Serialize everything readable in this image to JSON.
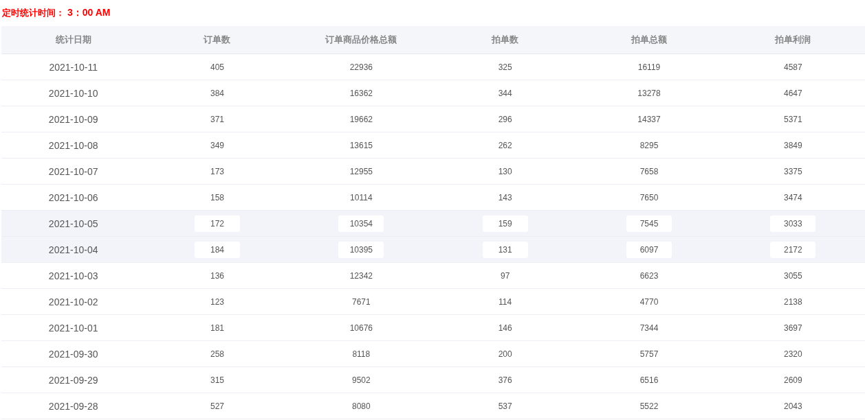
{
  "schedule_label": "定时统计时间：",
  "schedule_time": "3：00 AM",
  "table": {
    "columns": [
      "统计日期",
      "订单数",
      "订单商品价格总额",
      "拍单数",
      "拍单总额",
      "拍单利润"
    ],
    "rows": [
      {
        "cells": [
          "2021-10-11",
          "405",
          "22936",
          "325",
          "16119",
          "4587"
        ],
        "highlighted": false
      },
      {
        "cells": [
          "2021-10-10",
          "384",
          "16362",
          "344",
          "13278",
          "4647"
        ],
        "highlighted": false
      },
      {
        "cells": [
          "2021-10-09",
          "371",
          "19662",
          "296",
          "14337",
          "5371"
        ],
        "highlighted": false
      },
      {
        "cells": [
          "2021-10-08",
          "349",
          "13615",
          "262",
          "8295",
          "3849"
        ],
        "highlighted": false
      },
      {
        "cells": [
          "2021-10-07",
          "173",
          "12955",
          "130",
          "7658",
          "3375"
        ],
        "highlighted": false
      },
      {
        "cells": [
          "2021-10-06",
          "158",
          "10114",
          "143",
          "7650",
          "3474"
        ],
        "highlighted": false
      },
      {
        "cells": [
          "2021-10-05",
          "172",
          "10354",
          "159",
          "7545",
          "3033"
        ],
        "highlighted": true
      },
      {
        "cells": [
          "2021-10-04",
          "184",
          "10395",
          "131",
          "6097",
          "2172"
        ],
        "highlighted": true
      },
      {
        "cells": [
          "2021-10-03",
          "136",
          "12342",
          "97",
          "6623",
          "3055"
        ],
        "highlighted": false
      },
      {
        "cells": [
          "2021-10-02",
          "123",
          "7671",
          "114",
          "4770",
          "2138"
        ],
        "highlighted": false
      },
      {
        "cells": [
          "2021-10-01",
          "181",
          "10676",
          "146",
          "7344",
          "3697"
        ],
        "highlighted": false
      },
      {
        "cells": [
          "2021-09-30",
          "258",
          "8118",
          "200",
          "5757",
          "2320"
        ],
        "highlighted": false
      },
      {
        "cells": [
          "2021-09-29",
          "315",
          "9502",
          "376",
          "6516",
          "2609"
        ],
        "highlighted": false
      },
      {
        "cells": [
          "2021-09-28",
          "527",
          "8080",
          "537",
          "5522",
          "2043"
        ],
        "highlighted": false
      }
    ]
  }
}
